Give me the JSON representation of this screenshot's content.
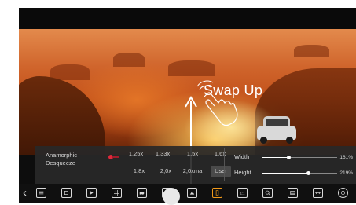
{
  "overlay": {
    "gesture_label": "Swap Up",
    "gesture_icon": "hand-pointer-icon"
  },
  "aspect_panel": {
    "anamorphic_line1": "Anamorphic",
    "anamorphic_line2": "Desqueeze",
    "anamorphic_enabled": true,
    "ratios_row1": [
      "1,25x",
      "1,33x",
      "1,5x",
      "1,6x"
    ],
    "ratios_row2": [
      "1,8x",
      "2,0x",
      "2,0xma",
      "User"
    ],
    "selected_ratio": "User",
    "width_label": "Width",
    "width_value": "161%",
    "width_level": 0.35,
    "height_label": "Height",
    "height_value": "219%",
    "height_level": 0.62
  },
  "toolbar": {
    "items": [
      "back-icon",
      "list-icon",
      "frame-icon",
      "play-frame-icon",
      "grid-icon",
      "video-settings-icon",
      "stripe-pattern-icon",
      "image-icon",
      "frame-guide-icon",
      "one-to-one-icon",
      "zoom-in-icon",
      "aspect-window-icon",
      "stretch-icon",
      "overlay-circle-icon"
    ],
    "active_item": "frame-guide-icon",
    "accent_color": "#f29a1a"
  }
}
